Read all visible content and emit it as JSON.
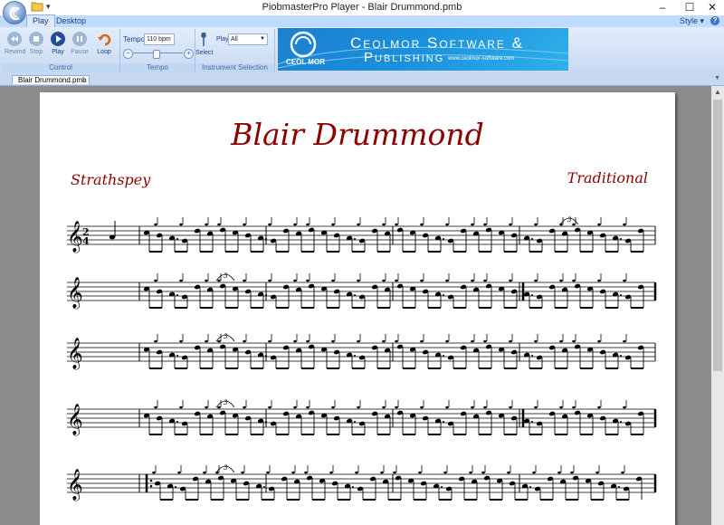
{
  "window": {
    "title": "PiobmasterPro Player - Blair Drummond.pmb",
    "minimize": "–",
    "maximize": "☐",
    "close": "✕"
  },
  "ribbon": {
    "tabs": [
      {
        "label": "Play",
        "active": true
      },
      {
        "label": "Desktop",
        "active": false
      }
    ],
    "style_label": "Style",
    "help_glyph": "?",
    "control_group": {
      "label": "Control",
      "buttons": [
        {
          "label": "Rewind",
          "icon": "rewind-icon",
          "enabled": false
        },
        {
          "label": "Stop",
          "icon": "stop-icon",
          "enabled": false
        },
        {
          "label": "Play",
          "icon": "play-icon",
          "enabled": true
        },
        {
          "label": "Pause",
          "icon": "pause-icon",
          "enabled": false
        },
        {
          "label": "Loop",
          "icon": "loop-icon",
          "enabled": true
        }
      ]
    },
    "tempo_group": {
      "label": "Tempo",
      "tempo_label": "Tempo:",
      "tempo_value": "110 bpm",
      "slider_level": 0.45,
      "minus": "−",
      "plus": "+"
    },
    "instrument_group": {
      "label": "Instrument Selection",
      "play_label": "Play:",
      "play_value": "All",
      "select_label": "Select"
    },
    "banner": {
      "line1": "Ceolmor Software &",
      "line2": "Publishing",
      "url": "www.ceolmor-software.com",
      "logo_text": "CEOL MOR"
    }
  },
  "document": {
    "tab_label": "Blair Drummond.pmb",
    "tab_close": "×",
    "tune_title": "Blair Drummond",
    "tune_type": "Strathspey",
    "composer": "Traditional",
    "time_signature_top": "2",
    "time_signature_bottom": "4",
    "triplet_mark": "3",
    "staff_count": 5
  },
  "colors": {
    "title_red": "#8b0000",
    "ribbon_blue": "#c7d9f1",
    "banner_blue": "#1a8fdc"
  }
}
